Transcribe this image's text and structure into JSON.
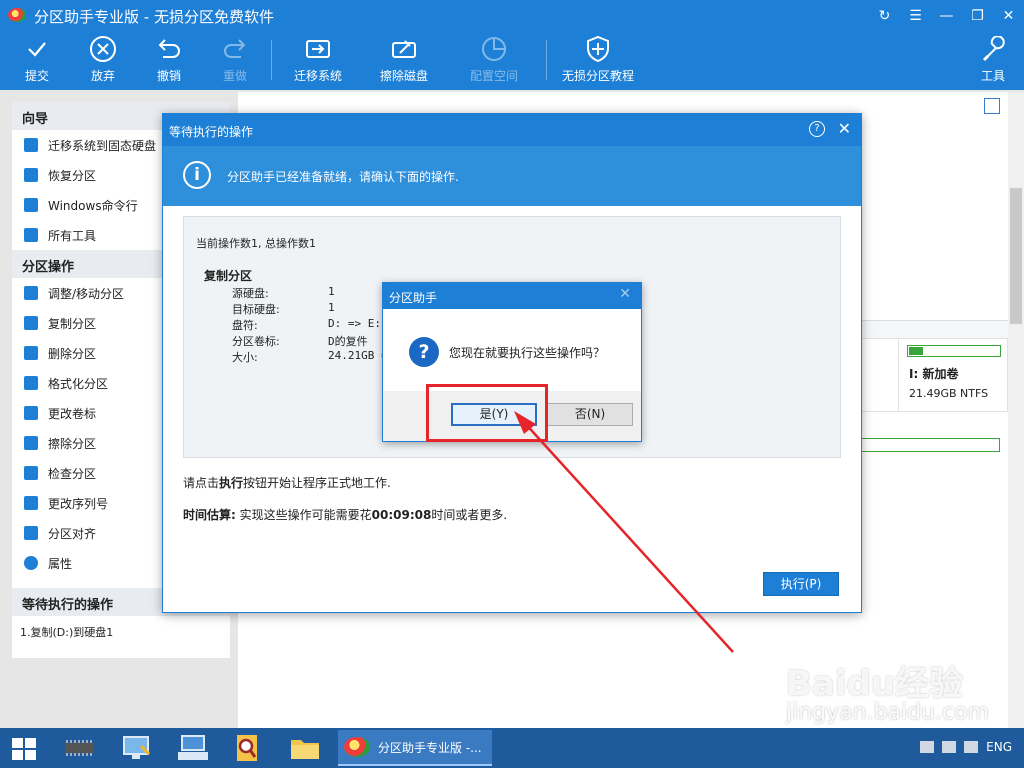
{
  "window": {
    "title": "分区助手专业版 - 无损分区免费软件"
  },
  "toolbar": {
    "items": [
      {
        "label": "提交",
        "icon": "check-icon",
        "enabled": true
      },
      {
        "label": "放弃",
        "icon": "discard-icon",
        "enabled": true
      },
      {
        "label": "撤销",
        "icon": "undo-icon",
        "enabled": true
      },
      {
        "label": "重做",
        "icon": "redo-icon",
        "enabled": false
      },
      {
        "label": "迁移系统",
        "icon": "migrate-icon",
        "enabled": true
      },
      {
        "label": "擦除磁盘",
        "icon": "wipe-disk-icon",
        "enabled": true
      },
      {
        "label": "配置空间",
        "icon": "allocate-space-icon",
        "enabled": false
      },
      {
        "label": "无损分区教程",
        "icon": "shield-icon",
        "enabled": true
      },
      {
        "label": "工具",
        "icon": "tools-icon",
        "enabled": true
      }
    ]
  },
  "sidebar": {
    "wizard_title": "向导",
    "wizard_items": [
      "迁移系统到固态硬盘",
      "恢复分区",
      "Windows命令行",
      "所有工具"
    ],
    "ops_title": "分区操作",
    "ops_items": [
      "调整/移动分区",
      "复制分区",
      "删除分区",
      "格式化分区",
      "更改卷标",
      "擦除分区",
      "检查分区",
      "更改序列号",
      "分区对齐",
      "属性"
    ],
    "pending_title": "等待执行的操作",
    "pending_items": [
      "1.复制(D:)到硬盘1"
    ]
  },
  "disk_view": {
    "volume_name": "I: 新加卷",
    "volume_info": "21.49GB NTFS"
  },
  "pending_dialog": {
    "title": "等待执行的操作",
    "banner": "分区助手已经准备就绪，请确认下面的操作.",
    "op_count": "当前操作数1, 总操作数1",
    "op_name": "复制分区",
    "rows": [
      {
        "key": "源硬盘:",
        "value": "1"
      },
      {
        "key": "目标硬盘:",
        "value": "1"
      },
      {
        "key": "盘符:",
        "value": "D: => E:"
      },
      {
        "key": "分区卷标:",
        "value": "D的复件"
      },
      {
        "key": "大小:",
        "value": "24.21GB ="
      }
    ],
    "note_prefix": "请点击",
    "note_bold": "执行",
    "note_suffix": "按钮开始让程序正式地工作.",
    "estimate_label": "时间估算:",
    "estimate_mid": " 实现这些操作可能需要花",
    "estimate_time": "00:09:08",
    "estimate_suffix": "时间或者更多.",
    "execute_label": "执行(P)"
  },
  "confirm_box": {
    "title": "分区助手",
    "question": "您现在就要执行这些操作吗？",
    "yes_label": "是(Y)",
    "no_label": "否(N)"
  },
  "taskbar": {
    "active_task": "分区助手专业版 -...",
    "language": "ENG"
  },
  "watermark": {
    "brand": "Baidu经验",
    "url": "jingyan.baidu.com"
  },
  "colors": {
    "accent": "#1d7fd6",
    "highlight": "#e5252a"
  }
}
